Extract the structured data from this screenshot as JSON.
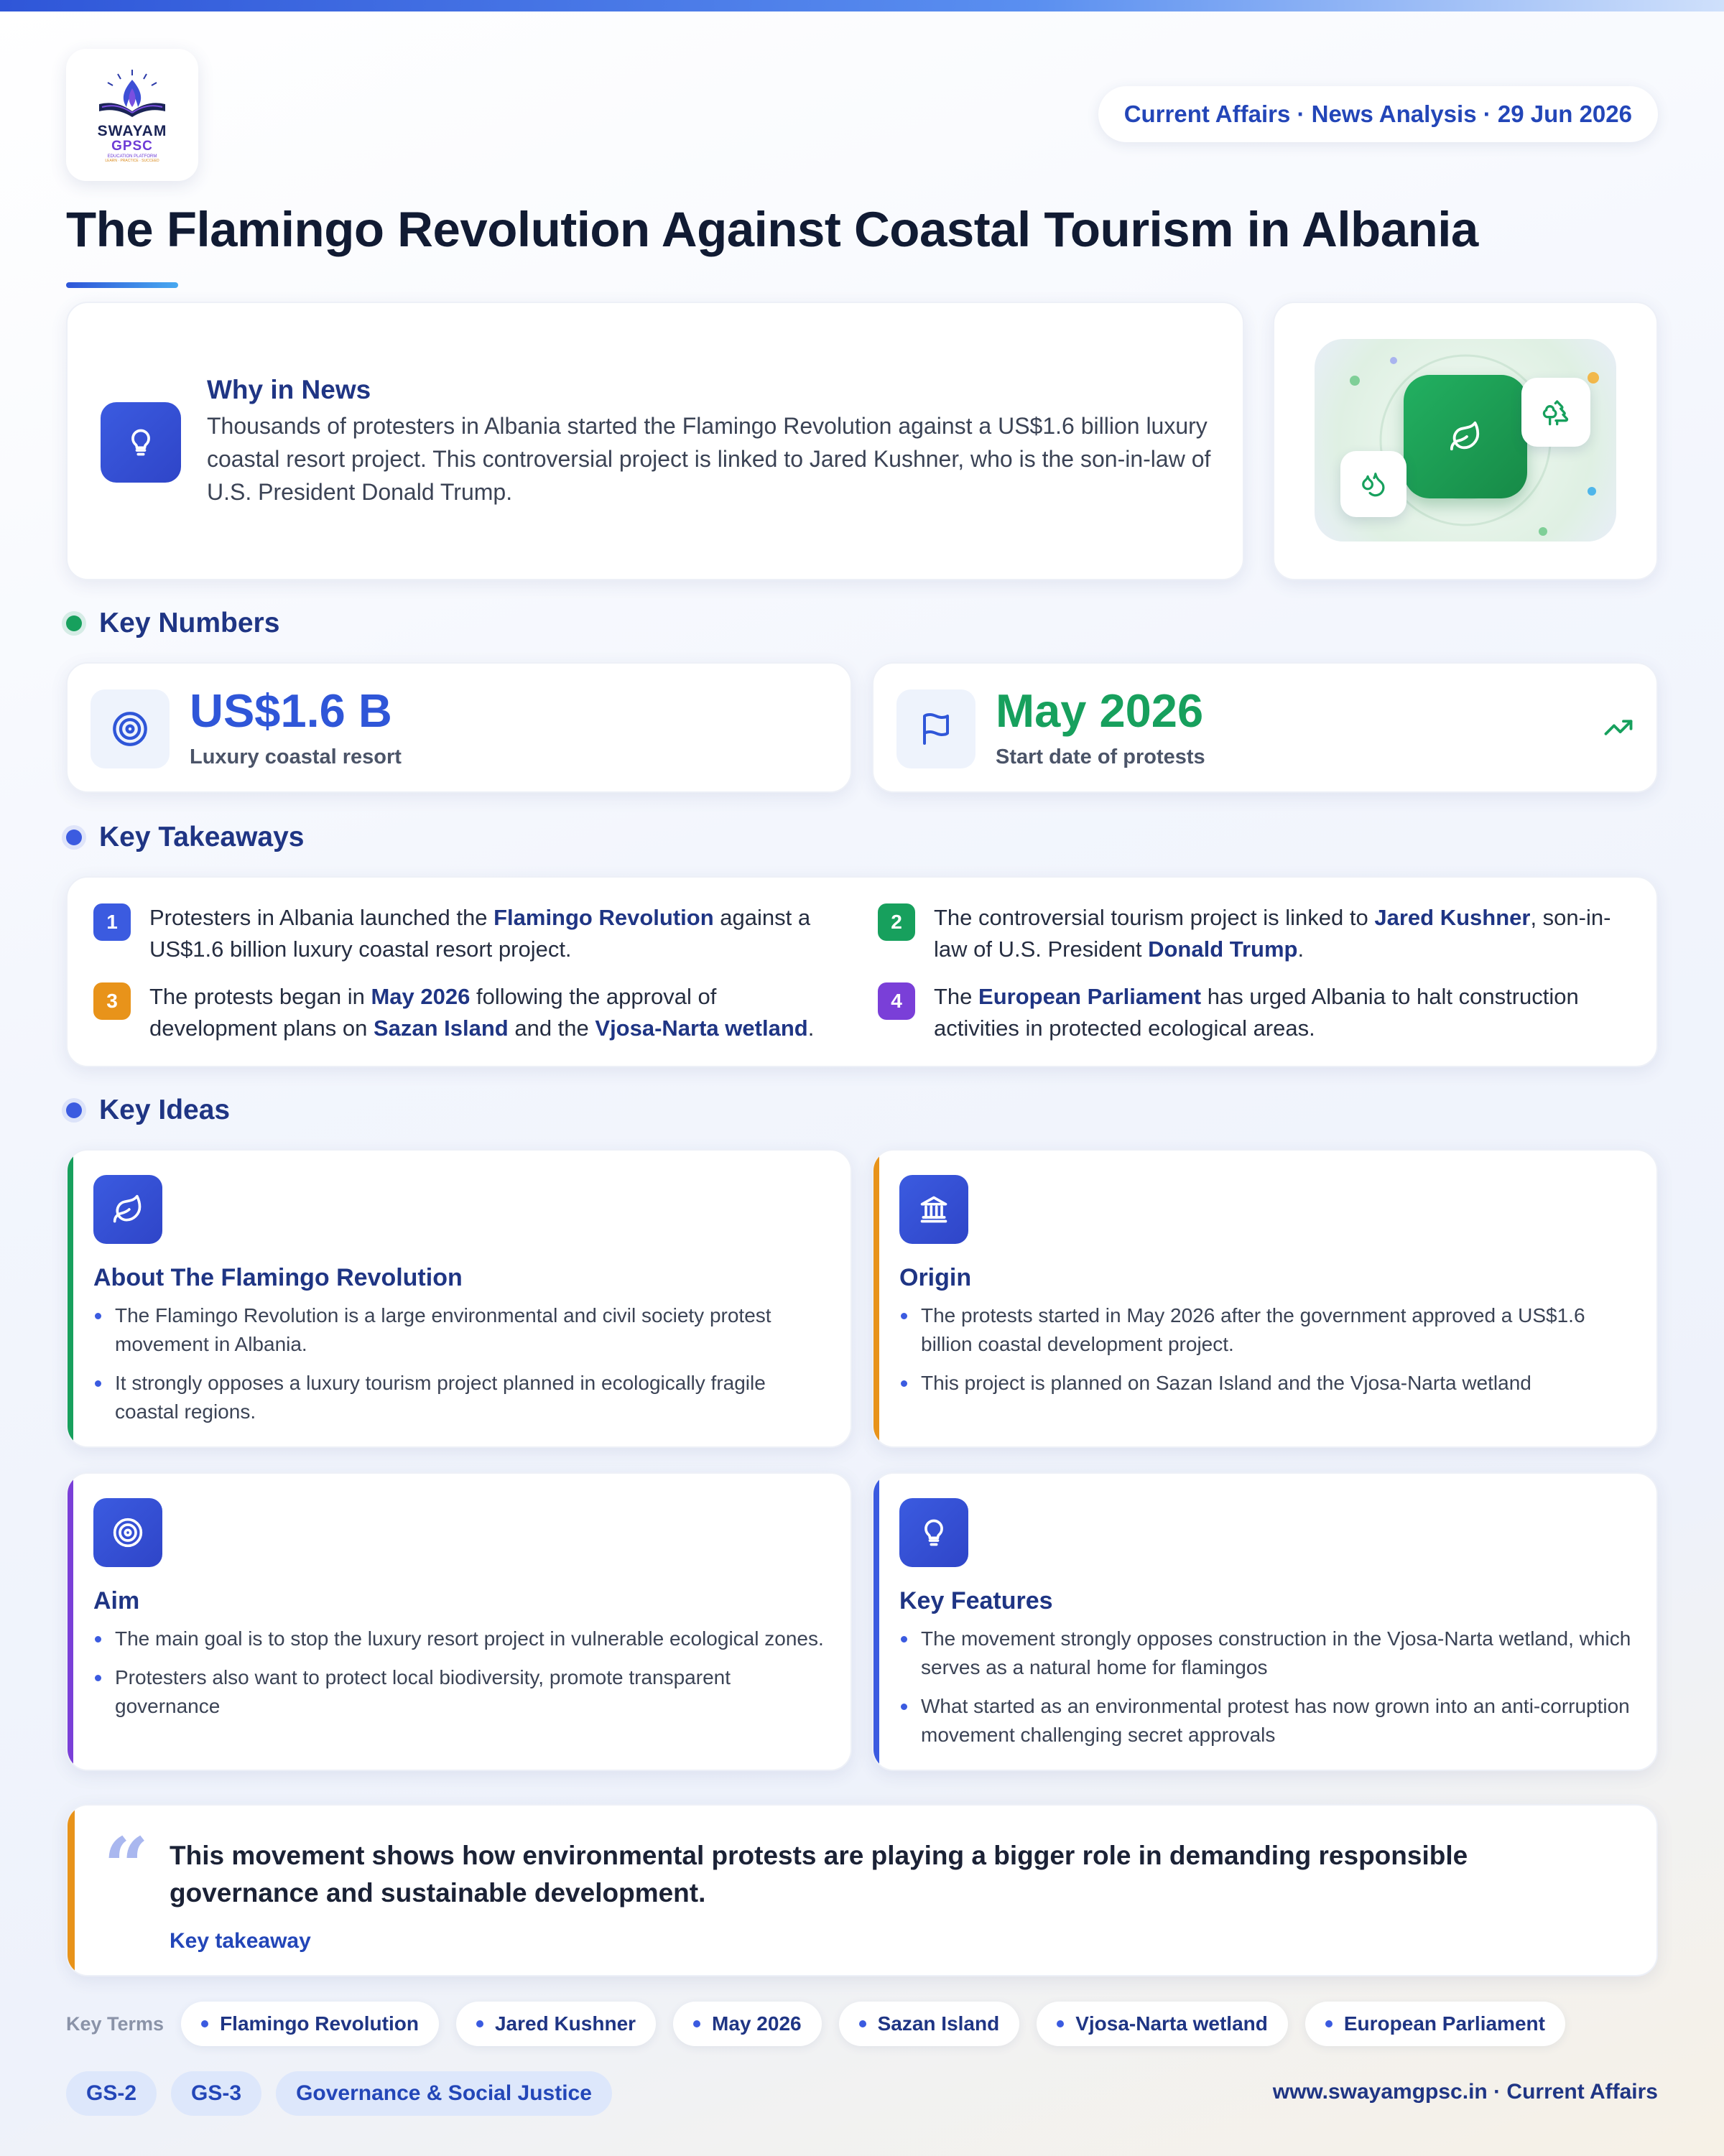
{
  "brand": {
    "logo_line1": "SWAYAM",
    "logo_line2": "GPSC",
    "logo_line3": "EDUCATION PLATFORM",
    "logo_line4": "LEARN · PRACTICE · SUCCEED"
  },
  "meta": "Current Affairs · News Analysis · 29 Jun 2026",
  "title": "The Flamingo Revolution Against Coastal Tourism in Albania",
  "why": {
    "title": "Why in News",
    "text": "Thousands of protesters in Albania started the Flamingo Revolution against a US$1.6 billion luxury coastal resort project. This controversial project is linked to Jared Kushner, who is the son-in-law of U.S. President Donald Trump."
  },
  "key_numbers": {
    "heading": "Key Numbers",
    "items": [
      {
        "value": "US$1.6 B",
        "label": "Luxury coastal resort",
        "color": "#2f56d8",
        "icon": "target-icon"
      },
      {
        "value": "May 2026",
        "label": "Start date of protests",
        "color": "#17a05d",
        "icon": "flag-icon"
      }
    ]
  },
  "takeaways": {
    "heading": "Key Takeaways",
    "items": [
      {
        "num": "1",
        "color": "#3b5be0",
        "parts": [
          {
            "t": "Protesters in Albania launched the "
          },
          {
            "t": "Flamingo Revolution",
            "b": true
          },
          {
            "t": " against a US$1.6 billion luxury coastal resort project."
          }
        ]
      },
      {
        "num": "2",
        "color": "#17a05d",
        "parts": [
          {
            "t": "The controversial tourism project is linked to "
          },
          {
            "t": "Jared Kushner",
            "b": true
          },
          {
            "t": ", son-in-law of U.S. President "
          },
          {
            "t": "Donald Trump",
            "b": true
          },
          {
            "t": "."
          }
        ]
      },
      {
        "num": "3",
        "color": "#e8931a",
        "parts": [
          {
            "t": "The protests began in "
          },
          {
            "t": "May 2026",
            "b": true
          },
          {
            "t": " following the approval of development plans on "
          },
          {
            "t": "Sazan Island",
            "b": true
          },
          {
            "t": " and the "
          },
          {
            "t": "Vjosa-Narta wetland",
            "b": true
          },
          {
            "t": "."
          }
        ]
      },
      {
        "num": "4",
        "color": "#7a3fd8",
        "parts": [
          {
            "t": "The "
          },
          {
            "t": "European Parliament",
            "b": true
          },
          {
            "t": " has urged Albania to halt construction activities in protected ecological areas."
          }
        ]
      }
    ]
  },
  "ideas": {
    "heading": "Key Ideas",
    "cards": [
      {
        "title": "About The Flamingo Revolution",
        "icon": "leaf-icon",
        "stripe": "#17a05d",
        "points": [
          "The Flamingo Revolution is a large environmental and civil society protest movement in Albania.",
          "It strongly opposes a luxury tourism project planned in ecologically fragile coastal regions."
        ]
      },
      {
        "title": "Origin",
        "icon": "institution-icon",
        "stripe": "#e8931a",
        "points": [
          "The protests started in May 2026 after the government approved a US$1.6 billion coastal development project.",
          "This project is planned on Sazan Island and the Vjosa-Narta wetland"
        ]
      },
      {
        "title": "Aim",
        "icon": "target-icon",
        "stripe": "#7a3fd8",
        "points": [
          "The main goal is to stop the luxury resort project in vulnerable ecological zones.",
          "Protesters also want to protect local biodiversity, promote transparent governance"
        ]
      },
      {
        "title": "Key Features",
        "icon": "lightbulb-icon",
        "stripe": "#3b5be0",
        "points": [
          "The movement strongly opposes construction in the Vjosa-Narta wetland, which serves as a natural home for flamingos",
          "What started as an environmental protest has now grown into an anti-corruption movement challenging secret approvals"
        ]
      }
    ]
  },
  "quote": {
    "mark": "“",
    "text": "This movement shows how environmental protests are playing a bigger role in demanding responsible governance and sustainable development.",
    "label": "Key takeaway"
  },
  "terms": {
    "label": "Key Terms",
    "items": [
      "Flamingo Revolution",
      "Jared Kushner",
      "May 2026",
      "Sazan Island",
      "Vjosa-Narta wetland",
      "European Parliament"
    ]
  },
  "tags": [
    "GS-2",
    "GS-3",
    "Governance & Social Justice"
  ],
  "footer": "www.swayamgpsc.in · Current Affairs",
  "colors": {
    "accent": "#2f56d8",
    "brand_dark": "#1f3584",
    "green": "#17a05d",
    "orange": "#e8931a",
    "purple": "#7a3fd8"
  }
}
